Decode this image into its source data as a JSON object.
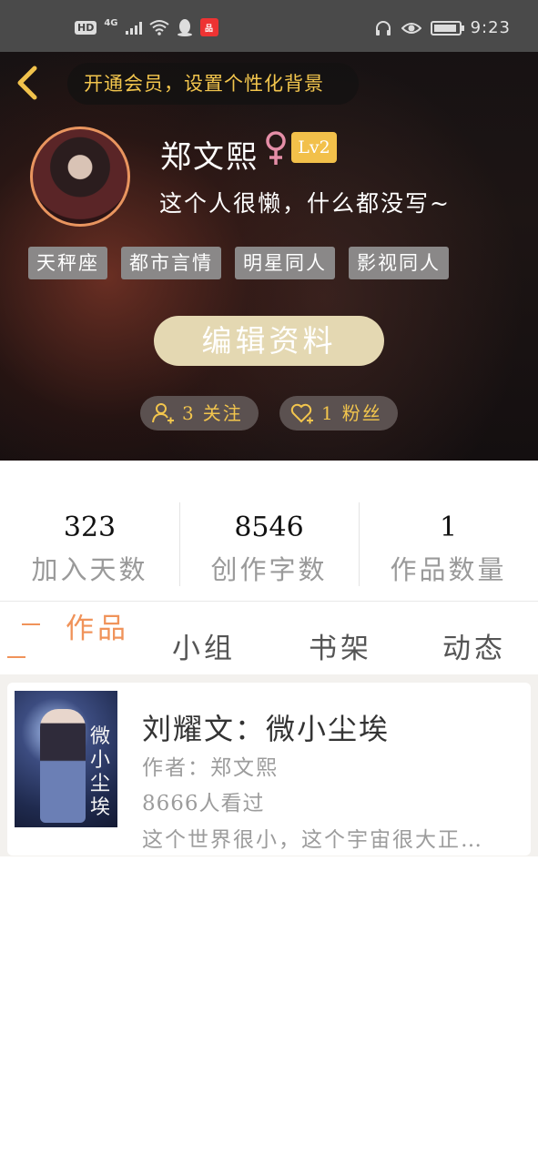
{
  "status_bar": {
    "network_hd": "HD",
    "network_type": "4G",
    "app_badge": "品",
    "time": "9:23",
    "icons": [
      "signal-icon",
      "wifi-icon",
      "qq-icon",
      "app-icon",
      "headset-icon",
      "eye-icon",
      "battery-icon"
    ]
  },
  "header": {
    "vip_banner": "开通会员，设置个性化背景",
    "username": "郑文熙",
    "gender": "female",
    "level": "Lv2",
    "signature": "这个人很懒，什么都没写~",
    "tags": [
      "天秤座",
      "都市言情",
      "明星同人",
      "影视同人"
    ],
    "edit_button": "编辑资料",
    "following": {
      "count": "3",
      "label": "关注"
    },
    "fans": {
      "count": "1",
      "label": "粉丝"
    }
  },
  "stats": [
    {
      "value": "323",
      "label": "加入天数"
    },
    {
      "value": "8546",
      "label": "创作字数"
    },
    {
      "value": "1",
      "label": "作品数量"
    }
  ],
  "tabs": [
    {
      "label": "作品",
      "active": true
    },
    {
      "label": "小组",
      "active": false
    },
    {
      "label": "书架",
      "active": false
    },
    {
      "label": "动态",
      "active": false
    }
  ],
  "works": [
    {
      "cover_title": "微小尘埃",
      "title": "刘耀文：微小尘埃",
      "author": "作者：郑文熙",
      "views": "8666人看过",
      "description": "这个世界很小，这个宇宙很大正…"
    }
  ],
  "colors": {
    "accent": "#f0935a",
    "gold": "#f2c54d",
    "level_badge": "#f2c04a",
    "edit_button": "#e4d8b2",
    "tag_bg": "#8a8888"
  }
}
